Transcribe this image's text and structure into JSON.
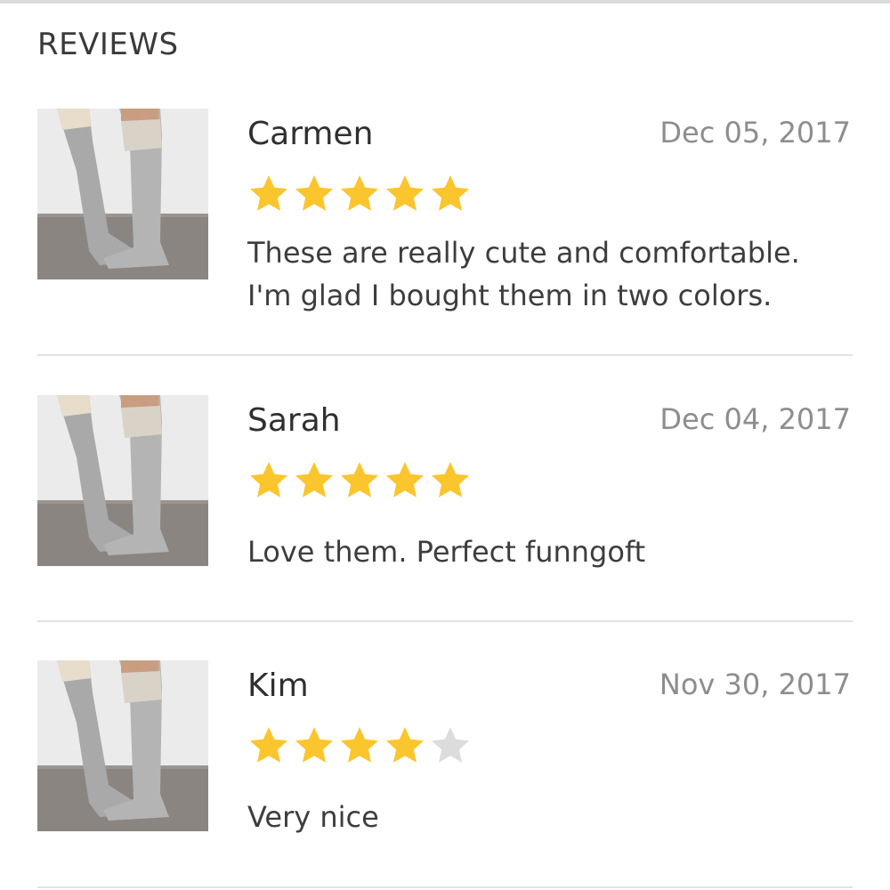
{
  "header": {
    "title": "REVIEWS"
  },
  "reviews": [
    {
      "name": "Carmen",
      "date": "Dec 05, 2017",
      "rating": 5,
      "text_lines": [
        "These are really cute and comfortable.",
        "I'm glad I bought them in two colors."
      ]
    },
    {
      "name": "Sarah",
      "date": "Dec 04, 2017",
      "rating": 5,
      "text_lines": [
        "Love them. Perfect funngoft"
      ]
    },
    {
      "name": "Kim",
      "date": "Nov 30, 2017",
      "rating": 4,
      "text_lines": [
        "Very nice"
      ]
    }
  ],
  "colors": {
    "star_filled": "#fbc52d",
    "star_empty": "#dcdcdc"
  },
  "icons": {
    "star": "star-icon"
  }
}
